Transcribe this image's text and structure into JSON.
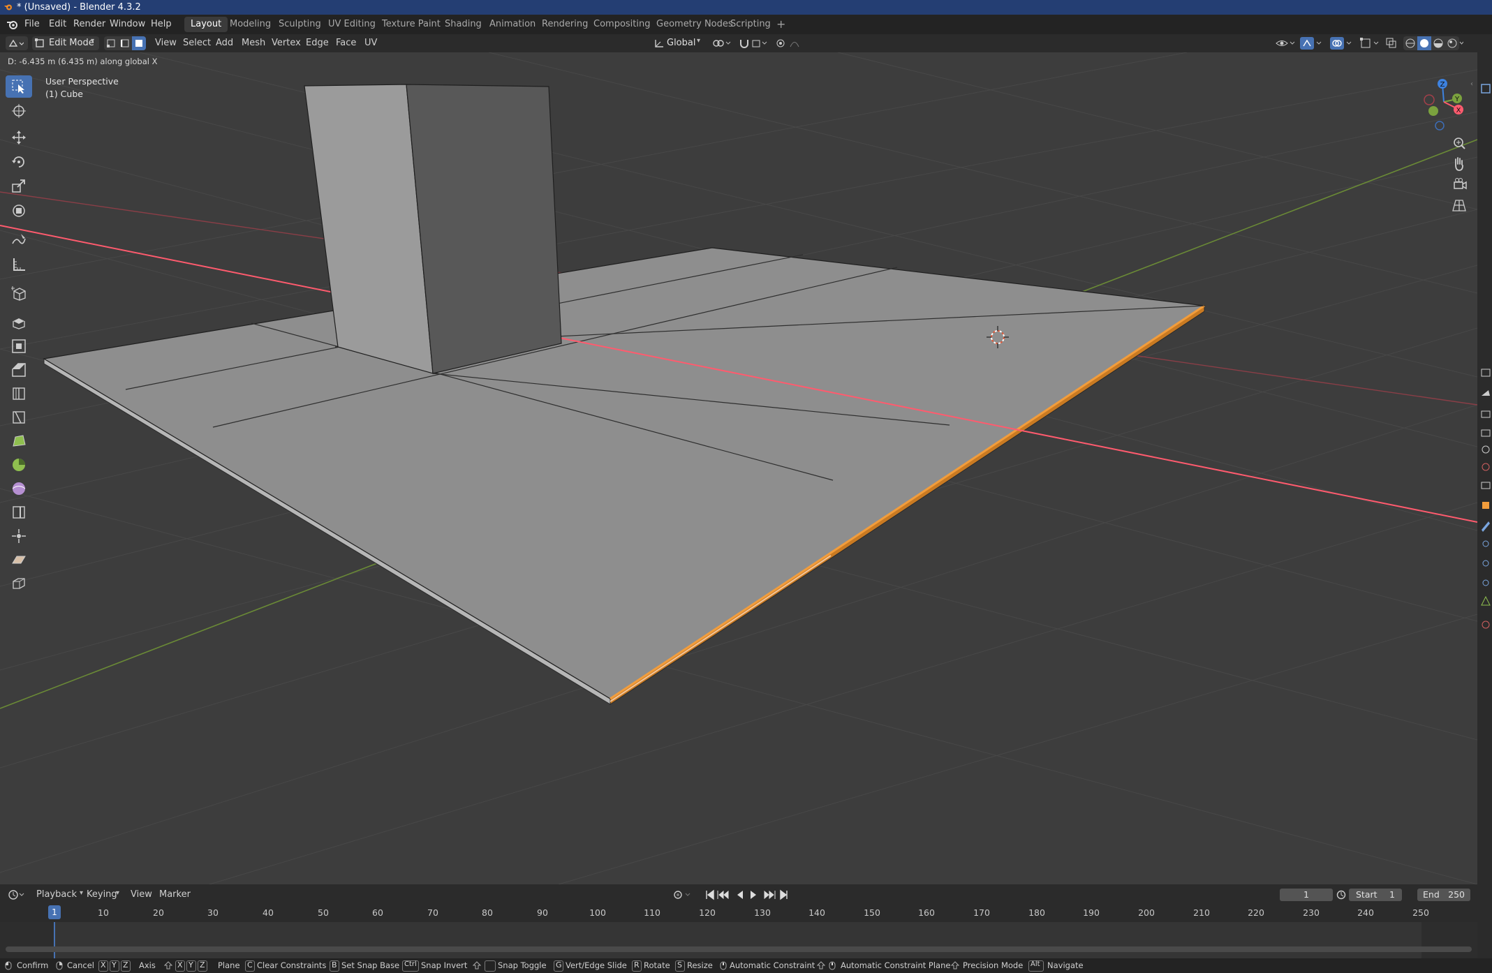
{
  "window": {
    "title": "* (Unsaved) - Blender 4.3.2"
  },
  "menu": [
    "File",
    "Edit",
    "Render",
    "Window",
    "Help"
  ],
  "workspaces": [
    "Layout",
    "Modeling",
    "Sculpting",
    "UV Editing",
    "Texture Paint",
    "Shading",
    "Animation",
    "Rendering",
    "Compositing",
    "Geometry Nodes",
    "Scripting"
  ],
  "active_workspace": "Layout",
  "header": {
    "mode": "Edit Mode",
    "menus": [
      "View",
      "Select",
      "Add",
      "Mesh",
      "Vertex",
      "Edge",
      "Face",
      "UV"
    ],
    "orientation": "Global"
  },
  "viewport": {
    "operator_status": "D: -6.435 m (6.435 m) along global X",
    "view_name": "User Perspective",
    "object_name": "(1) Cube",
    "gizmo_axes": [
      "Z",
      "Y",
      "X"
    ],
    "colors": {
      "x_axis": "#ff5b6e",
      "y_axis": "#7ba23e",
      "z_axis": "#3d82e0",
      "selection": "#f29d3c",
      "mesh_face": "#8e8e8e"
    }
  },
  "timeline": {
    "menus": [
      "Playback",
      "Keying",
      "View",
      "Marker"
    ],
    "current_frame": "1",
    "start_label": "Start",
    "start": "1",
    "end_label": "End",
    "end": "250",
    "ticks": [
      "10",
      "20",
      "30",
      "40",
      "50",
      "60",
      "70",
      "80",
      "90",
      "100",
      "110",
      "120",
      "130",
      "140",
      "150",
      "160",
      "170",
      "180",
      "190",
      "200",
      "210",
      "220",
      "230",
      "240",
      "250"
    ]
  },
  "statusbar": {
    "confirm": "Confirm",
    "cancel": "Cancel",
    "axis": "Axis",
    "plane": "Plane",
    "clear_constraints": "Clear Constraints",
    "set_snap_base": "Set Snap Base",
    "snap_invert": "Snap Invert",
    "snap_toggle": "Snap Toggle",
    "vert_edge_slide": "Vert/Edge Slide",
    "rotate": "Rotate",
    "resize": "Resize",
    "automatic_constraint": "Automatic Constraint",
    "automatic_constraint_plane": "Automatic Constraint Plane",
    "precision_mode": "Precision Mode",
    "navigate": "Navigate",
    "keys": {
      "x": "X",
      "y": "Y",
      "z": "Z",
      "c": "C",
      "b": "B",
      "ctrl": "Ctrl",
      "g": "G",
      "r": "R",
      "s": "S",
      "alt": "Alt"
    }
  }
}
